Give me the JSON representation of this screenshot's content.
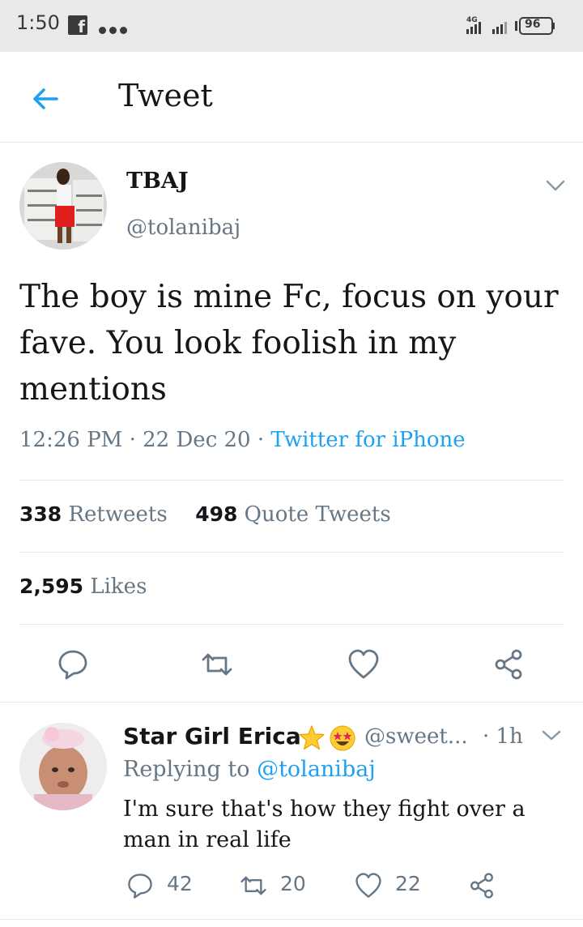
{
  "status_bar": {
    "time": "1:50",
    "network": "4G",
    "battery": "96",
    "icons": [
      "facebook-icon",
      "more-dots-icon",
      "signal-icon",
      "battery-icon"
    ]
  },
  "header": {
    "title": "Tweet",
    "back_icon": "back-arrow-icon"
  },
  "tweet": {
    "author_name": "TBAJ",
    "author_handle": "@tolanibaj",
    "text": "The boy is mine Fc, focus on your fave. You look foolish in my mentions",
    "time": "12:26 PM",
    "date": "22 Dec 20",
    "separator": "·",
    "source": "Twitter for iPhone",
    "retweets_count": "338",
    "retweets_label": "Retweets",
    "quote_count": "498",
    "quote_label": "Quote Tweets",
    "likes_count": "2,595",
    "likes_label": "Likes",
    "actions": [
      "reply-icon",
      "retweet-icon",
      "like-icon",
      "share-icon"
    ]
  },
  "reply": {
    "author_name": "Star Girl Erica",
    "author_handle": "@sweet...",
    "time": "· 1h",
    "replying_prefix": "Replying to",
    "replying_to": "@tolanibaj",
    "text": "I'm sure that's how they fight over a man in real life",
    "reply_count": "42",
    "retweet_count": "20",
    "like_count": "22"
  },
  "colors": {
    "accent": "#1da1f2",
    "secondary_text": "#657786",
    "divider": "#e1e8ed",
    "status_bar_bg": "#e9e9ea"
  }
}
